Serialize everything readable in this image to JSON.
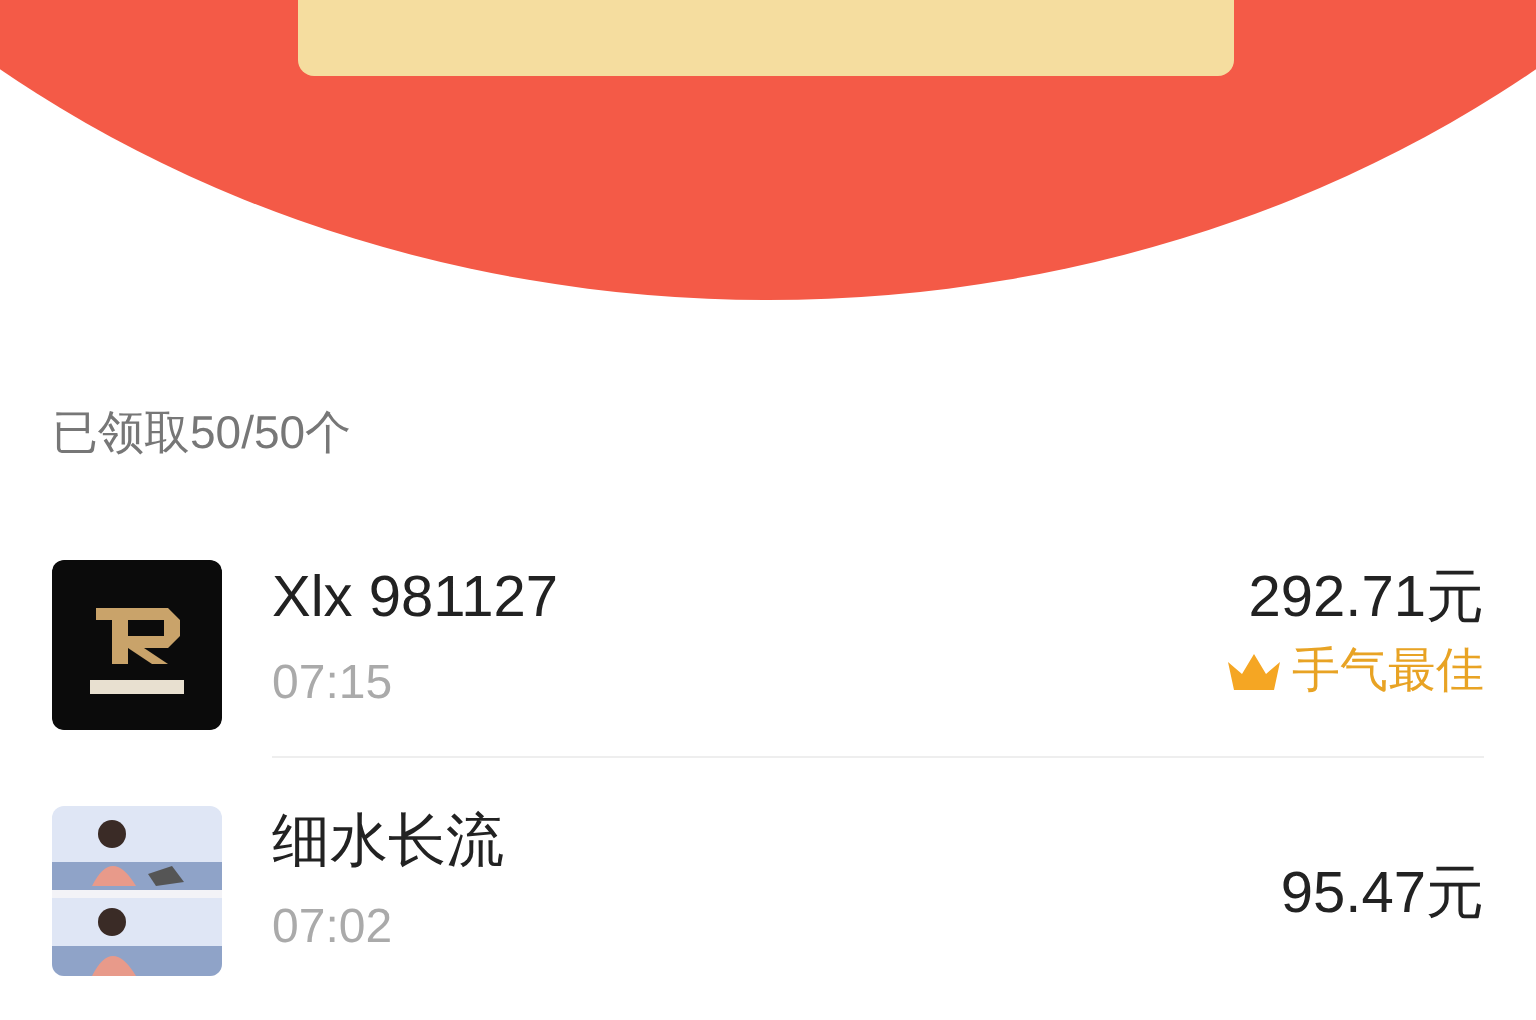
{
  "summary": "已领取50/50个",
  "records": [
    {
      "name": "Xlx 981127",
      "time": "07:15",
      "amount": "292.71元",
      "best": true,
      "best_label": "手气最佳",
      "kind": "logo"
    },
    {
      "name": "细水长流",
      "time": "07:02",
      "amount": "95.47元",
      "best": false,
      "kind": "picture"
    }
  ]
}
